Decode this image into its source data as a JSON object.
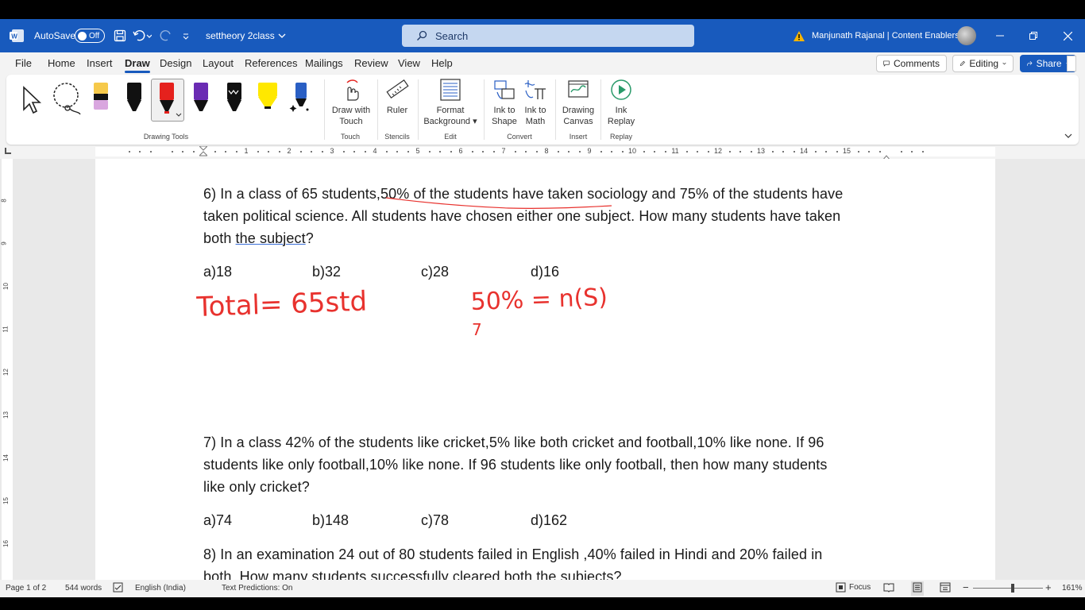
{
  "titlebar": {
    "autosave_label": "AutoSave",
    "autosave_state": "Off",
    "doc_title": "settheory 2class",
    "search_placeholder": "Search",
    "account_name": "Manjunath Rajanal | Content Enablers"
  },
  "menu": {
    "tabs": [
      "File",
      "Home",
      "Insert",
      "Draw",
      "Design",
      "Layout",
      "References",
      "Mailings",
      "Review",
      "View",
      "Help"
    ],
    "active": "Draw",
    "comments_label": "Comments",
    "editing_label": "Editing",
    "share_label": "Share"
  },
  "ribbon": {
    "groups": {
      "drawing_tools": "Drawing Tools",
      "touch": "Touch",
      "stencils": "Stencils",
      "edit": "Edit",
      "convert": "Convert",
      "insert": "Insert",
      "replay": "Replay"
    },
    "buttons": {
      "draw_with_touch": [
        "Draw with",
        "Touch"
      ],
      "ruler": "Ruler",
      "format_background": [
        "Format",
        "Background"
      ],
      "ink_to_shape": [
        "Ink to",
        "Shape"
      ],
      "ink_to_math": [
        "Ink to",
        "Math"
      ],
      "drawing_canvas": [
        "Drawing",
        "Canvas"
      ],
      "ink_replay": [
        "Ink",
        "Replay"
      ]
    },
    "pens": [
      {
        "name": "highlighter-pen-yellow-pink",
        "color": "#f6c94a"
      },
      {
        "name": "pen-black",
        "color": "#111111"
      },
      {
        "name": "pen-red",
        "color": "#e5211d"
      },
      {
        "name": "pen-purple",
        "color": "#6a2bb3"
      },
      {
        "name": "pen-black-pattern",
        "color": "#111111"
      },
      {
        "name": "highlighter-yellow",
        "color": "#ffe800"
      },
      {
        "name": "pen-galaxy-blue",
        "color": "#2a5fc4"
      }
    ]
  },
  "ruler": {
    "numbers": [
      "1",
      "2",
      "3",
      "4",
      "5",
      "6",
      "7",
      "8",
      "9",
      "10",
      "11",
      "12",
      "13",
      "14",
      "15"
    ],
    "vertical_numbers": [
      "8",
      "9",
      "10",
      "11",
      "12",
      "13",
      "14",
      "15",
      "16",
      "17"
    ]
  },
  "document": {
    "q6": {
      "line1_a": "6) In a class of 65 students,",
      "line1_b": "50% of the students have taken sociology and 75% of the students have",
      "line2": "taken political science. All students have chosen either one subject. How many students have taken",
      "line3_a": "both ",
      "line3_b": "the  subject",
      "line3_c": "?",
      "options": [
        "a)18",
        "b)32",
        "c)28",
        "d)16"
      ]
    },
    "q7": {
      "line1": "7) In a class 42% of the students like cricket,5% like both cricket and football,10% like none. If 96",
      "line2": "students like only football,10% like none. If 96 students like only football, then how many students",
      "line3": "like only cricket?",
      "options": [
        "a)74",
        "b)148",
        "c)78",
        "d)162"
      ]
    },
    "q8": {
      "line1": "8) In an examination 24 out of 80 students failed in English ,40% failed in Hindi and 20% failed in",
      "line2": "both. How many students successfully cleared both the subjects?"
    },
    "ink": {
      "color": "#e8322e",
      "note1": "Total= 65std",
      "note2": "50% = n(S)",
      "note3": "7"
    }
  },
  "status": {
    "page": "Page 1 of 2",
    "words": "544 words",
    "language": "English (India)",
    "text_predictions": "Text Predictions: On",
    "focus": "Focus",
    "zoom": "161%"
  }
}
